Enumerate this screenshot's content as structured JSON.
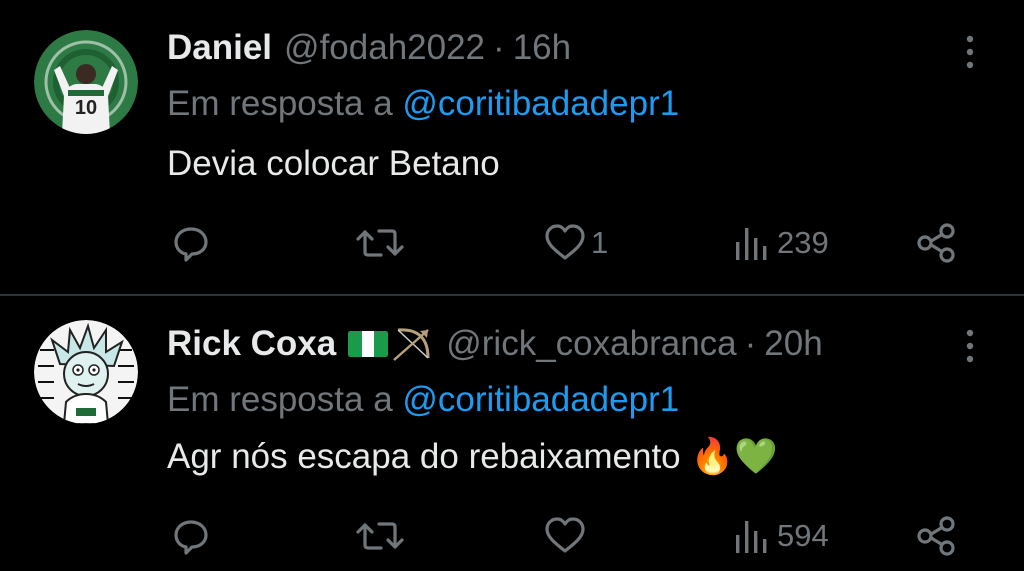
{
  "tweets": [
    {
      "name": "Daniel",
      "handle": "@fodah2022",
      "separator": "·",
      "time": "16h",
      "reply_prefix": "Em resposta a",
      "reply_to": "@coritibadadepr1",
      "text": "Devia colocar Betano",
      "emoji": "",
      "likes": "1",
      "views": "239",
      "avatar_jersey_number": "10"
    },
    {
      "name": "Rick Coxa",
      "handle": "@rick_coxabranca",
      "separator": "·",
      "time": "20h",
      "reply_prefix": "Em resposta a",
      "reply_to": "@coritibadadepr1",
      "text": "Agr nós escapa do rebaixamento",
      "emoji": "🔥💚",
      "likes": "",
      "views": "594"
    }
  ],
  "icons": {
    "more": "more-vertical-icon",
    "reply": "reply-icon",
    "retweet": "retweet-icon",
    "like": "heart-icon",
    "views": "views-icon",
    "share": "share-icon",
    "flag": "nigeria-flag-icon",
    "bow": "bow-and-arrow-icon"
  },
  "colors": {
    "background": "#000000",
    "text": "#e7e9ea",
    "muted": "#71767b",
    "link": "#1d9bf0",
    "divider": "#2f3336"
  }
}
